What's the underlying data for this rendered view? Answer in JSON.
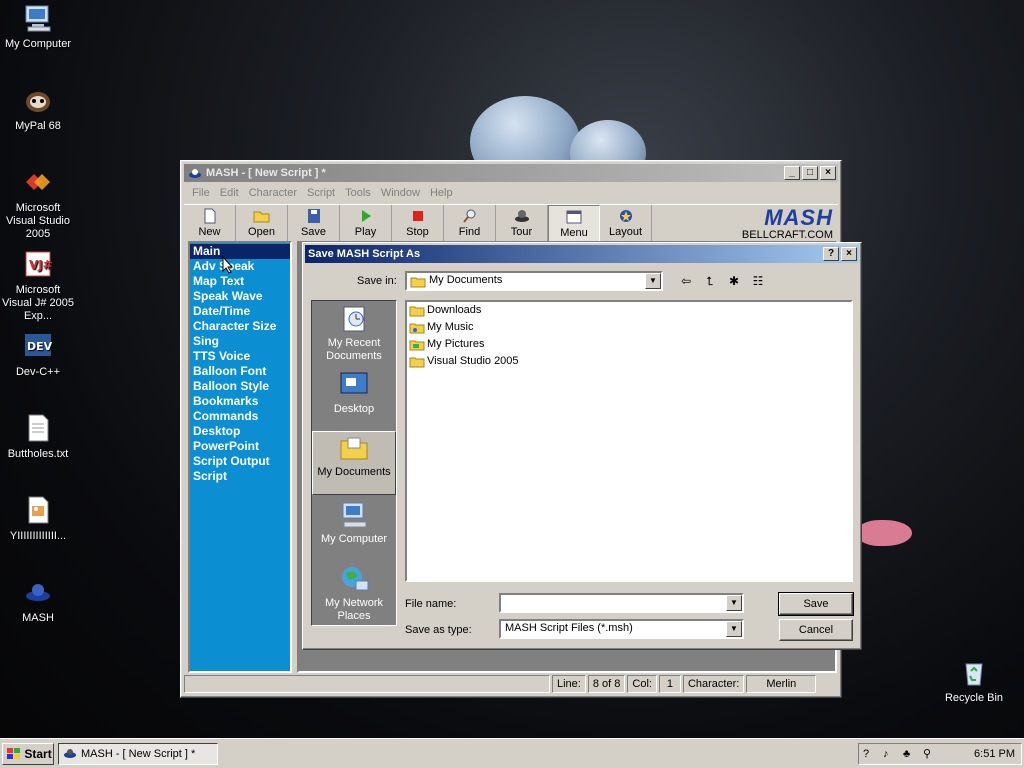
{
  "desktop": {
    "icons": [
      {
        "label": "My Computer",
        "icon": "computer-icon"
      },
      {
        "label": "MyPal 68",
        "icon": "mypal-icon"
      },
      {
        "label": "Microsoft Visual Studio 2005",
        "icon": "visual-studio-icon"
      },
      {
        "label": "Microsoft Visual J# 2005 Exp...",
        "icon": "visual-j-icon"
      },
      {
        "label": "Dev-C++",
        "icon": "devcpp-icon"
      },
      {
        "label": "Buttholes.txt",
        "icon": "text-file-icon"
      },
      {
        "label": "YIIIIIIIIIIIII...",
        "icon": "image-file-icon"
      },
      {
        "label": "MASH",
        "icon": "mash-icon"
      },
      {
        "label": "Recycle Bin",
        "icon": "recycle-bin-icon"
      }
    ]
  },
  "mash": {
    "title": "MASH - [ New Script ] *",
    "menu": [
      "File",
      "Edit",
      "Character",
      "Script",
      "Tools",
      "Window",
      "Help"
    ],
    "toolbar": [
      "New",
      "Open",
      "Save",
      "Play",
      "Stop",
      "Find",
      "Tour",
      "Menu",
      "Layout"
    ],
    "brand_logo": "MASH",
    "brand_url": "BELLCRAFT.COM",
    "side_items": [
      "Main",
      "Adv Speak",
      "Map Text",
      "Speak Wave",
      "Date/Time",
      "Character Size",
      "Sing",
      "TTS Voice",
      "Balloon Font",
      "Balloon Style",
      "Bookmarks",
      "Commands",
      "Desktop",
      "PowerPoint",
      "Script Output",
      "Script"
    ],
    "status": {
      "line_label": "Line:",
      "line_value": "8 of 8",
      "col_label": "Col:",
      "col_value": "1",
      "character_label": "Character:",
      "character_value": "Merlin"
    }
  },
  "dialog": {
    "title": "Save MASH Script As",
    "save_in_label": "Save in:",
    "save_in_value": "My Documents",
    "places": [
      "My Recent Documents",
      "Desktop",
      "My Documents",
      "My Computer",
      "My Network Places"
    ],
    "files": [
      "Downloads",
      "My Music",
      "My Pictures",
      "Visual Studio 2005"
    ],
    "file_name_label": "File name:",
    "file_name_value": "",
    "save_as_type_label": "Save as type:",
    "save_as_type_value": "MASH Script Files (*.msh)",
    "save_button": "Save",
    "cancel_button": "Cancel"
  },
  "taskbar": {
    "start_label": "Start",
    "task_label": "MASH - [ New Script ] *",
    "clock": "6:51 PM"
  }
}
